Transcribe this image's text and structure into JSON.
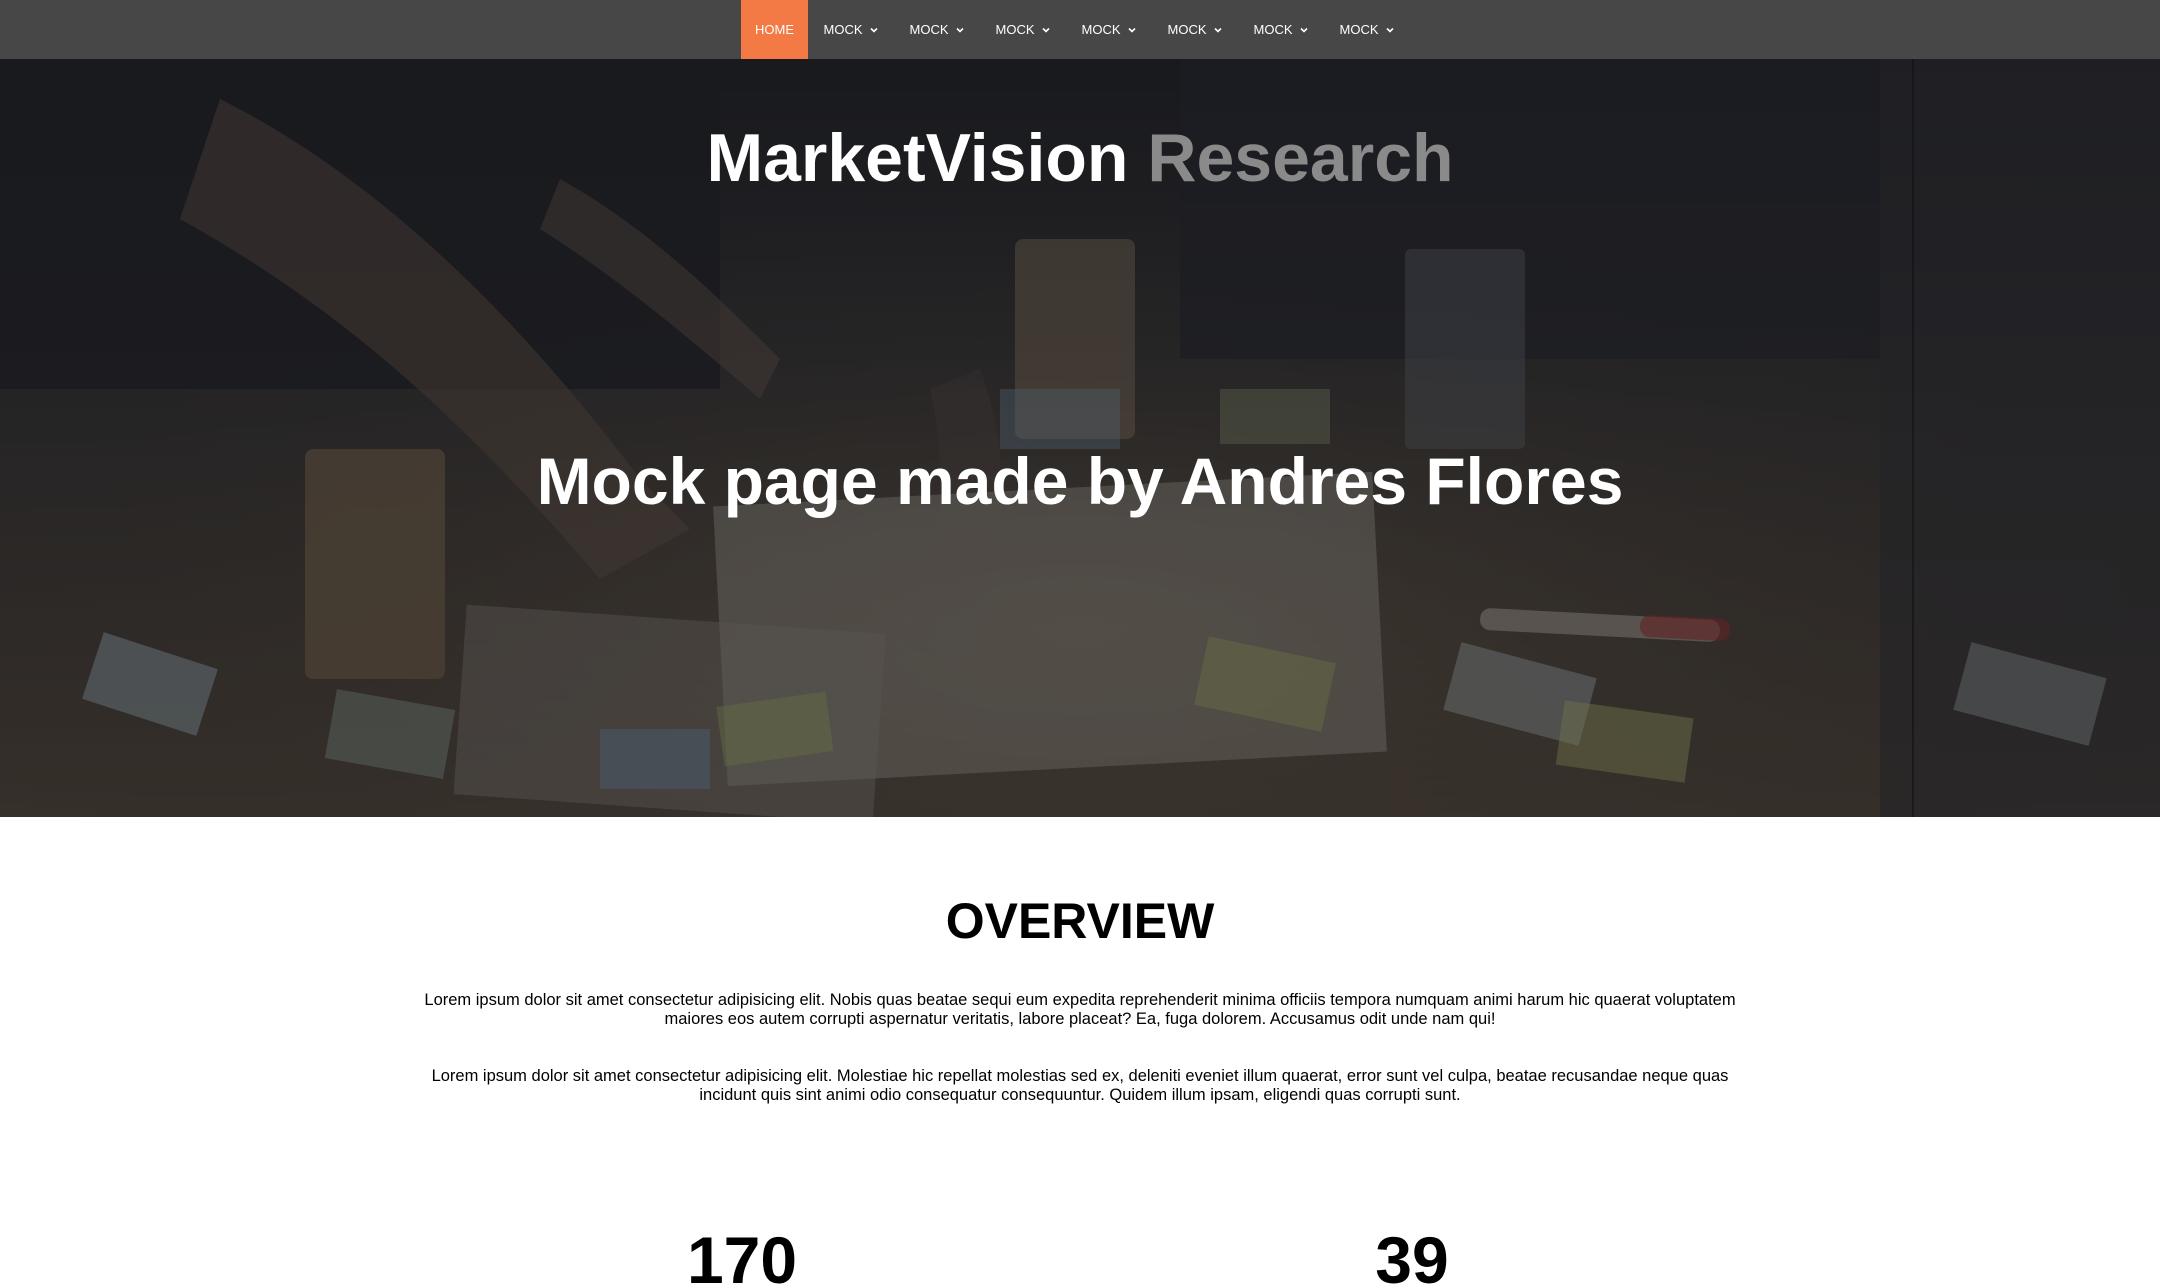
{
  "nav": {
    "items": [
      {
        "label": "HOME",
        "active": true
      },
      {
        "label": "MOCK",
        "dropdown": true
      },
      {
        "label": "MOCK",
        "dropdown": true
      },
      {
        "label": "MOCK",
        "dropdown": true
      },
      {
        "label": "MOCK",
        "dropdown": true
      },
      {
        "label": "MOCK",
        "dropdown": true
      },
      {
        "label": "MOCK",
        "dropdown": true
      },
      {
        "label": "MOCK",
        "dropdown": true
      }
    ],
    "active_color": "#f37a44",
    "bar_color": "#474747"
  },
  "hero": {
    "brand_primary": "MarketVision",
    "brand_secondary": "Research",
    "headline": "Mock page made by Andres Flores",
    "background_image": "team-meeting-photo"
  },
  "overview": {
    "title": "OVERVIEW",
    "paragraphs": [
      "Lorem ipsum dolor sit amet consectetur adipisicing elit. Nobis quas beatae sequi eum expedita reprehenderit minima officiis tempora numquam animi harum hic quaerat voluptatem maiores eos autem corrupti aspernatur veritatis, labore placeat? Ea, fuga dolorem. Accusamus odit unde nam qui!",
      "Lorem ipsum dolor sit amet consectetur adipisicing elit. Molestiae hic repellat molestias sed ex, deleniti eveniet illum quaerat, error sunt vel culpa, beatae recusandae neque quas incidunt quis sint animi odio consequatur consequuntur. Quidem illum ipsam, eligendi quas corrupti sunt."
    ]
  },
  "stats": [
    {
      "value": "170"
    },
    {
      "value": "39"
    }
  ]
}
